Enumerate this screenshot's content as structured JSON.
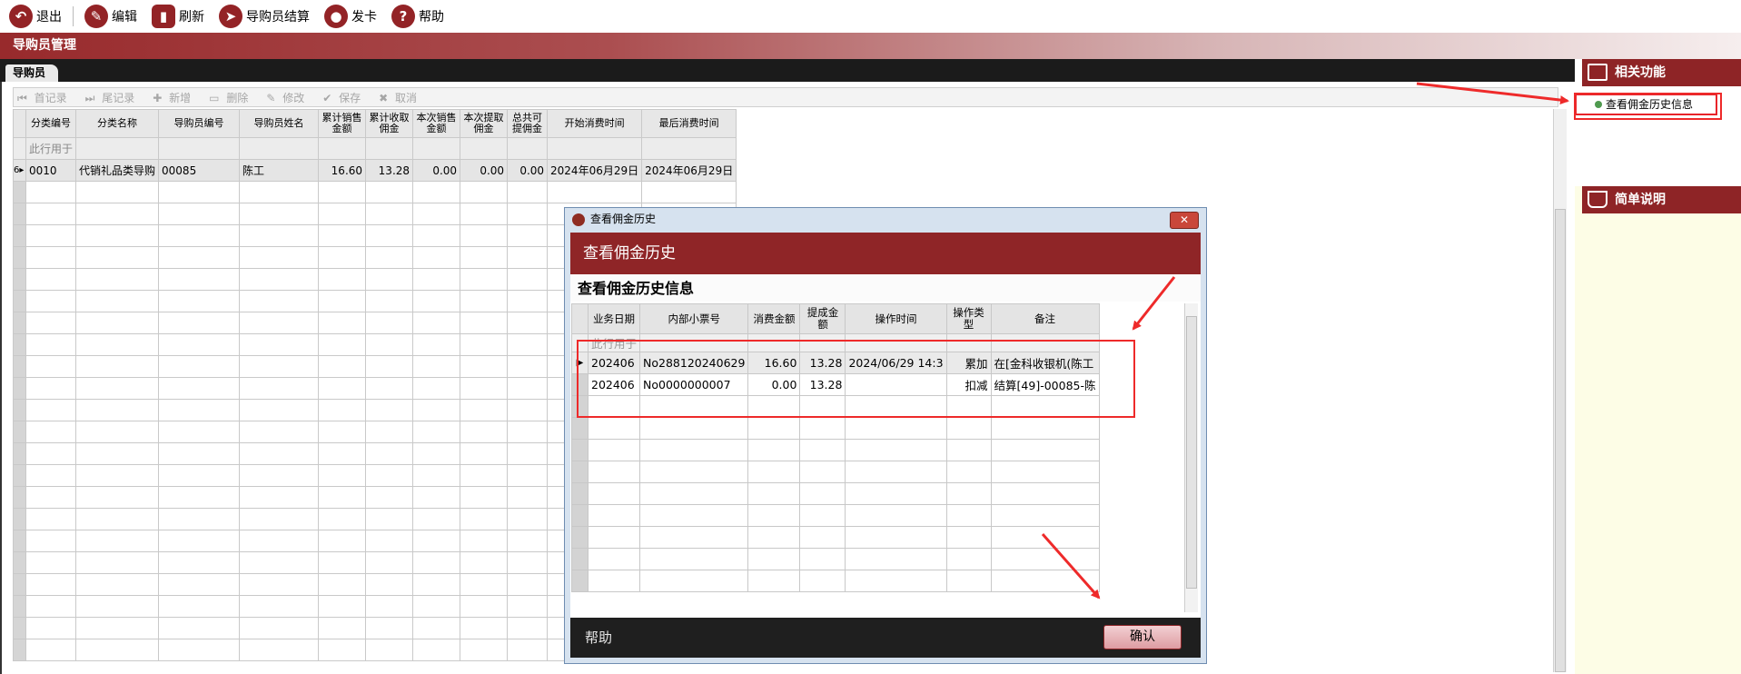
{
  "toolbar": {
    "exit": "退出",
    "edit": "编辑",
    "refresh": "刷新",
    "settle": "导购员结算",
    "issue_card": "发卡",
    "help": "帮助"
  },
  "title": "导购员管理",
  "tab": "导购员",
  "grid_toolbar": {
    "first": "首记录",
    "last": "尾记录",
    "add": "新增",
    "delete": "删除",
    "modify": "修改",
    "save": "保存",
    "cancel": "取消"
  },
  "grid": {
    "headers": [
      "分类编号",
      "分类名称",
      "导购员编号",
      "导购员姓名",
      "累计销售金额",
      "累计收取佣金",
      "本次销售金额",
      "本次提取佣金",
      "总共可提佣金",
      "开始消费时间",
      "最后消费时间"
    ],
    "filter_hint": "此行用于",
    "row_indicator": "6▸",
    "row": [
      "0010",
      "代销礼品类导购",
      "00085",
      "陈工",
      "16.60",
      "13.28",
      "0.00",
      "0.00",
      "0.00",
      "2024年06月29日",
      "2024年06月29日"
    ]
  },
  "side": {
    "related_title": "相关功能",
    "link": "查看佣金历史信息",
    "desc_title": "简单说明"
  },
  "dialog": {
    "window_title": "查看佣金历史",
    "header": "查看佣金历史",
    "subtitle": "查看佣金历史信息",
    "headers": [
      "业务日期",
      "内部小票号",
      "消费金额",
      "提成金额",
      "操作时间",
      "操作类型",
      "备注"
    ],
    "filter_hint": "此行用于",
    "rows": [
      [
        "202406",
        "No288120240629",
        "16.60",
        "13.28",
        "2024/06/29 14:3",
        "累加",
        "在[金科收银机(陈工"
      ],
      [
        "202406",
        "No0000000007",
        "0.00",
        "13.28",
        "",
        "扣减",
        "结算[49]-00085-陈"
      ]
    ],
    "help": "帮助",
    "ok": "确认",
    "close": "✕"
  },
  "colors": {
    "brand": "#8f2527",
    "annotation": "#ee2a2a"
  }
}
